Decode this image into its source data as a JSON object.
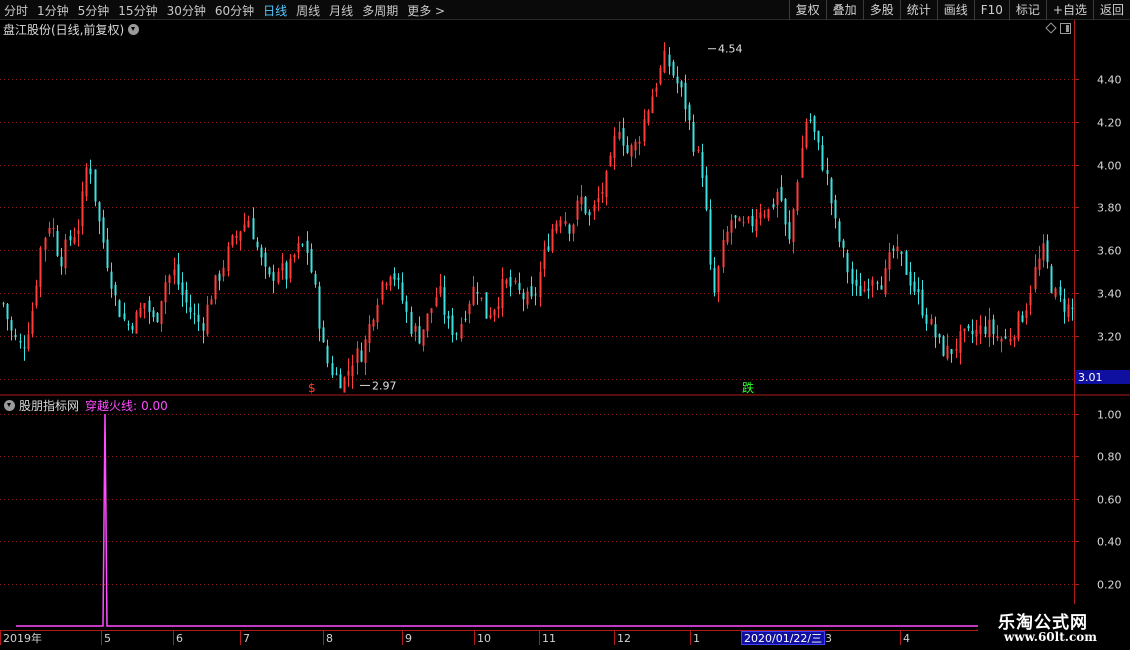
{
  "toolbar": {
    "periods": [
      {
        "label": "分时",
        "active": false
      },
      {
        "label": "1分钟",
        "active": false
      },
      {
        "label": "5分钟",
        "active": false
      },
      {
        "label": "15分钟",
        "active": false
      },
      {
        "label": "30分钟",
        "active": false
      },
      {
        "label": "60分钟",
        "active": false
      },
      {
        "label": "日线",
        "active": true
      },
      {
        "label": "周线",
        "active": false
      },
      {
        "label": "月线",
        "active": false
      },
      {
        "label": "多周期",
        "active": false
      },
      {
        "label": "更多 >",
        "active": false
      }
    ],
    "tools": [
      "复权",
      "叠加",
      "多股",
      "统计",
      "画线",
      "F10",
      "标记",
      "+自选",
      "返回"
    ]
  },
  "stock_title": "盘江股份(日线,前复权)",
  "indicator": {
    "name": "股朋指标网",
    "line_label": "穿越火线:",
    "value": "0.00"
  },
  "current_date_label": "2020/01/22/三",
  "watermark": {
    "title": "乐淘公式网",
    "url": "www.60lt.com"
  },
  "colors": {
    "up": "#ff3b3b",
    "down": "#3fe0e0",
    "grid": "#8a1c1c",
    "axis": "#b01a1a",
    "indicator_line": "#ff4cff",
    "accent": "#57c8ff"
  },
  "chart_data": [
    {
      "type": "candlestick",
      "title": "盘江股份(日线,前复权)",
      "y_ticks": [
        "4.40",
        "4.20",
        "4.00",
        "3.80",
        "3.60",
        "3.40",
        "3.20",
        "3.00"
      ],
      "ylim": [
        2.93,
        4.59
      ],
      "high_annotation": {
        "label": "4.54",
        "value": 4.54
      },
      "low_annotation": {
        "label": "2.97",
        "value": 2.97
      },
      "current_price_label": "3.01",
      "current_price": 3.01,
      "markers": [
        {
          "label": "$",
          "color": "#ff3b3b",
          "month": "8"
        },
        {
          "label": "跌",
          "color": "#33ff33",
          "month": "2020/01"
        }
      ],
      "x_ticks": [
        "2019年",
        "5",
        "6",
        "7",
        "8",
        "9",
        "10",
        "11",
        "12",
        "1",
        "2",
        "3",
        "4"
      ],
      "close_path": [
        3.35,
        3.2,
        3.14,
        3.3,
        3.62,
        3.75,
        3.55,
        3.65,
        3.72,
        4.05,
        3.75,
        3.55,
        3.35,
        3.25,
        3.28,
        3.36,
        3.25,
        3.45,
        3.5,
        3.38,
        3.3,
        3.25,
        3.4,
        3.5,
        3.62,
        3.7,
        3.75,
        3.58,
        3.45,
        3.52,
        3.48,
        3.6,
        3.62,
        3.4,
        3.1,
        3.02,
        2.99,
        3.1,
        3.13,
        3.3,
        3.45,
        3.52,
        3.4,
        3.25,
        3.2,
        3.3,
        3.42,
        3.25,
        3.22,
        3.35,
        3.45,
        3.3,
        3.35,
        3.45,
        3.42,
        3.38,
        3.35,
        3.55,
        3.7,
        3.78,
        3.7,
        3.85,
        3.75,
        3.85,
        3.95,
        4.2,
        4.05,
        4.1,
        4.25,
        4.38,
        4.5,
        4.4,
        4.3,
        4.1,
        3.95,
        3.35,
        3.6,
        3.75,
        3.7,
        3.72,
        3.8,
        3.78,
        3.9,
        3.6,
        3.95,
        4.25,
        4.1,
        3.95,
        3.7,
        3.55,
        3.4,
        3.42,
        3.5,
        3.45,
        3.6,
        3.55,
        3.45,
        3.35,
        3.25,
        3.15,
        3.12,
        3.18,
        3.2,
        3.22,
        3.25,
        3.2,
        3.18,
        3.25,
        3.32,
        3.5,
        3.6,
        3.4,
        3.35,
        3.32
      ]
    },
    {
      "type": "line",
      "title": "股朋指标网",
      "series": [
        {
          "name": "穿越火线",
          "color": "#ff4cff",
          "spike_month": "5",
          "spike_value": 1.0,
          "baseline": 0.0
        }
      ],
      "y_ticks": [
        "1.00",
        "0.80",
        "0.60",
        "0.40",
        "0.20"
      ],
      "ylim": [
        0.0,
        1.0
      ]
    }
  ]
}
